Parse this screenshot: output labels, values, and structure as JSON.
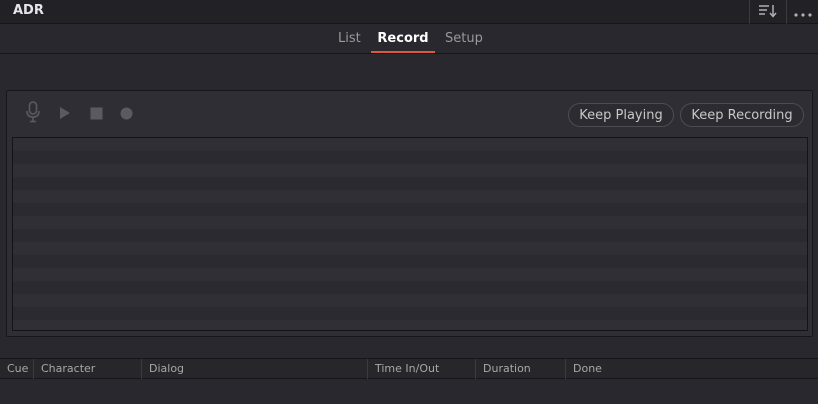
{
  "panel": {
    "title": "ADR",
    "header_icons": [
      "sort-icon",
      "more-options-icon"
    ]
  },
  "tabs": [
    {
      "label": "List",
      "active": false
    },
    {
      "label": "Record",
      "active": true
    },
    {
      "label": "Setup",
      "active": false
    }
  ],
  "recorder": {
    "transport_icons": [
      "microphone-icon",
      "play-icon",
      "stop-icon",
      "record-icon"
    ],
    "keep_playing_label": "Keep Playing",
    "keep_recording_label": "Keep Recording"
  },
  "cue_list": {
    "columns": [
      "Cue",
      "Character",
      "Dialog",
      "Time In/Out",
      "Duration",
      "Done"
    ],
    "rows": []
  },
  "colors": {
    "active_tab_underline": "#e0573c",
    "background": "#28282e"
  }
}
